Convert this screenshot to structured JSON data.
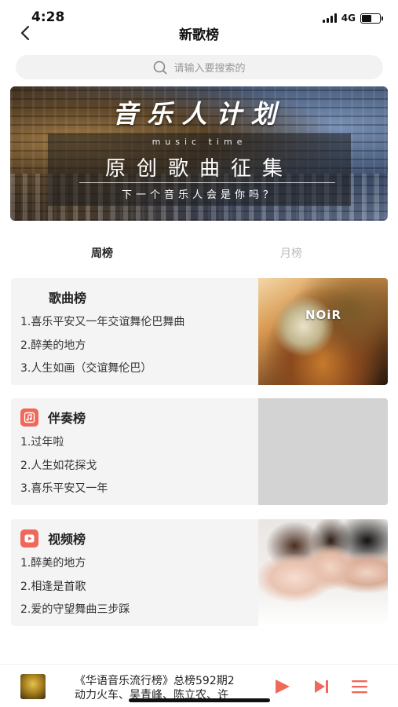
{
  "status": {
    "time": "4:28",
    "network": "4G",
    "battery_level": 0.55
  },
  "nav": {
    "title": "新歌榜",
    "back_icon": "chevron-left-icon"
  },
  "search": {
    "placeholder": "请输入要搜索的",
    "icon": "search-icon"
  },
  "banner": {
    "title": "音乐人计划",
    "eng": "music        time",
    "main": "原创歌曲征集",
    "sub": "下一个音乐人会是你吗？"
  },
  "tabs": [
    {
      "label": "周榜",
      "active": true
    },
    {
      "label": "月榜",
      "active": false
    }
  ],
  "charts": [
    {
      "title": "歌曲榜",
      "icon": null,
      "cover_text": "NOiR",
      "items": [
        "1.喜乐平安又一年交谊舞伦巴舞曲",
        "2.醉美的地方",
        "3.人生如画（交谊舞伦巴）"
      ]
    },
    {
      "title": "伴奏榜",
      "icon": "music-note-icon",
      "cover_text": "",
      "items": [
        "1.过年啦",
        "2.人生如花探戈",
        "3.喜乐平安又一年"
      ]
    },
    {
      "title": "视频榜",
      "icon": "video-play-icon",
      "cover_text": "",
      "items": [
        "1.醉美的地方",
        "2.相逢是首歌",
        "2.爱的守望舞曲三步踩"
      ]
    }
  ],
  "player": {
    "line1": "《华语音乐流行榜》总榜592期2",
    "line2": "动力火车、吴青峰、陈立农、许",
    "play_icon": "play-icon",
    "next_icon": "skip-next-icon",
    "list_icon": "playlist-icon"
  },
  "colors": {
    "accent": "#f0685a",
    "card_bg": "#f4f4f4",
    "inactive_tab": "#bbbbbb"
  }
}
